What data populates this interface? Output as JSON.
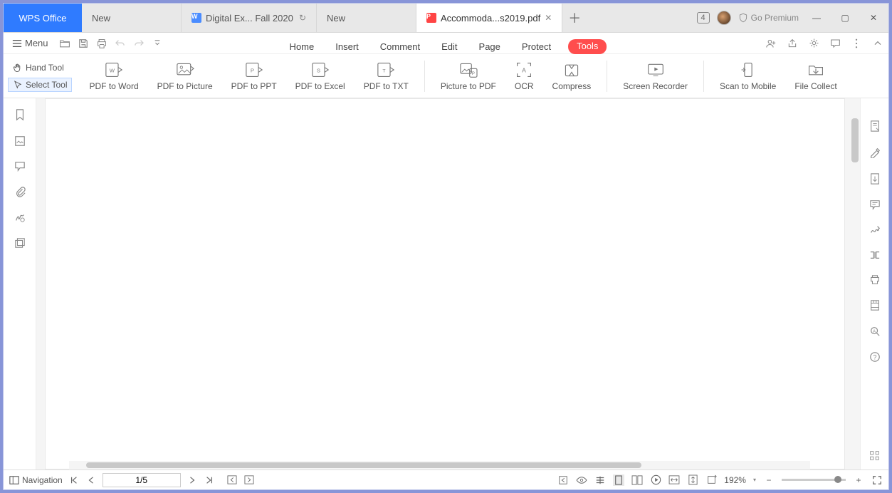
{
  "app": {
    "name": "WPS Office"
  },
  "tabs": [
    {
      "label": "New",
      "icon": null
    },
    {
      "label": "Digital Ex... Fall 2020",
      "icon": "W"
    },
    {
      "label": "New",
      "icon": null
    },
    {
      "label": "Accommoda...s2019.pdf",
      "icon": "P",
      "active": true
    }
  ],
  "title_right": {
    "count": "4",
    "premium": "Go Premium"
  },
  "menu": {
    "label": "Menu",
    "ribbon": [
      "Home",
      "Insert",
      "Comment",
      "Edit",
      "Page",
      "Protect",
      "Tools"
    ],
    "active_ribbon": "Tools"
  },
  "tool_side": {
    "hand": "Hand Tool",
    "select": "Select Tool"
  },
  "tools": [
    "PDF to Word",
    "PDF to Picture",
    "PDF to PPT",
    "PDF to Excel",
    "PDF to TXT",
    "Picture to PDF",
    "OCR",
    "Compress",
    "Screen Recorder",
    "Scan to Mobile",
    "File Collect"
  ],
  "status": {
    "navigation": "Navigation",
    "page": "1/5",
    "zoom": "192%"
  }
}
